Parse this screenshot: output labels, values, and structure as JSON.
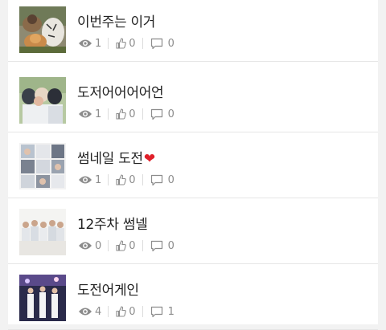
{
  "posts": [
    {
      "title": "이번주는 이거",
      "heart": "",
      "views": "1",
      "likes": "0",
      "comments": "0"
    },
    {
      "title": "도저어어어어언",
      "heart": "",
      "views": "1",
      "likes": "0",
      "comments": "0"
    },
    {
      "title": "썸네일 도전",
      "heart": "❤",
      "views": "1",
      "likes": "0",
      "comments": "0"
    },
    {
      "title": "12주차 썸넬",
      "heart": "",
      "views": "0",
      "likes": "0",
      "comments": "0"
    },
    {
      "title": "도전어게인",
      "heart": "",
      "views": "4",
      "likes": "0",
      "comments": "1"
    }
  ],
  "icons": {
    "views": "eye-icon",
    "likes": "thumbs-up-icon",
    "comments": "comment-bubble-icon"
  },
  "colors": {
    "meta_text": "#8c8c8c",
    "heart": "#e0202a",
    "divider": "#e6e6e6"
  }
}
